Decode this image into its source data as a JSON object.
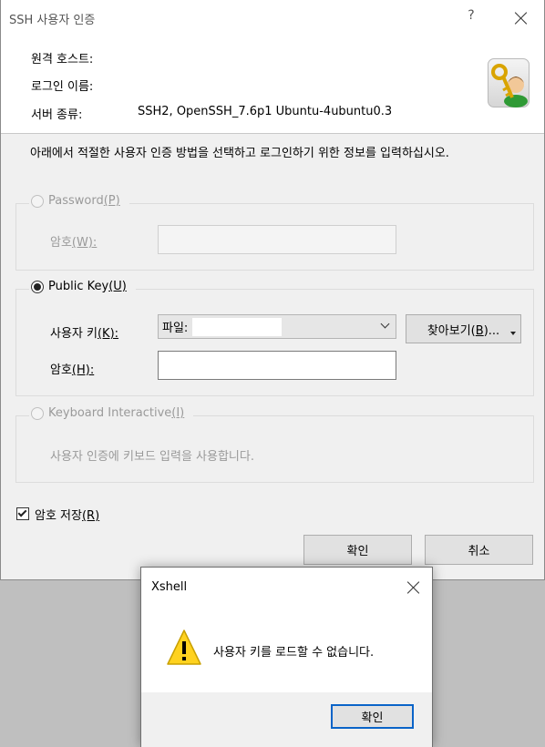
{
  "dialog": {
    "title": "SSH 사용자 인증",
    "help": "?",
    "info": {
      "remote_host_label": "원격 호스트:",
      "remote_host_value": "",
      "login_name_label": "로그인 이름:",
      "login_name_value": "",
      "server_type_label": "서버 종류:",
      "server_type_value": "SSH2, OpenSSH_7.6p1 Ubuntu-4ubuntu0.3",
      "icon": "user-key-icon"
    },
    "instructions": "아래에서 적절한 사용자 인증 방법을 선택하고 로그인하기 위한 정보를 입력하십시오.",
    "password_method": {
      "label": "Password",
      "accel": "(P)",
      "selected": false,
      "enabled": false,
      "password_label": "암호",
      "password_accel": "(W):"
    },
    "public_key_method": {
      "label": "Public Key",
      "accel": "(U)",
      "selected": true,
      "user_key_label": "사용자 키",
      "user_key_accel": "(K):",
      "user_key_prefix": "파일:",
      "browse_label": "찾아보기(",
      "browse_accel": "B",
      "browse_suffix": ")...",
      "passphrase_label": "암호",
      "passphrase_accel": "(H):"
    },
    "keyboard_method": {
      "label": "Keyboard Interactive",
      "accel": "(I)",
      "selected": false,
      "enabled": false,
      "description": "사용자 인증에 키보드 입력을 사용합니다."
    },
    "save_password": {
      "label": "암호 저장",
      "accel": "(R)",
      "checked": true
    },
    "ok_label": "확인",
    "cancel_label": "취소"
  },
  "error_dialog": {
    "title": "Xshell",
    "message": "사용자 키를 로드할 수 없습니다.",
    "icon": "warning-icon",
    "ok_label": "확인"
  },
  "colors": {
    "dialog_background": "#f0f0f0",
    "primary_button_border": "#0a64c8",
    "warning_yellow": "#ffd21f"
  }
}
